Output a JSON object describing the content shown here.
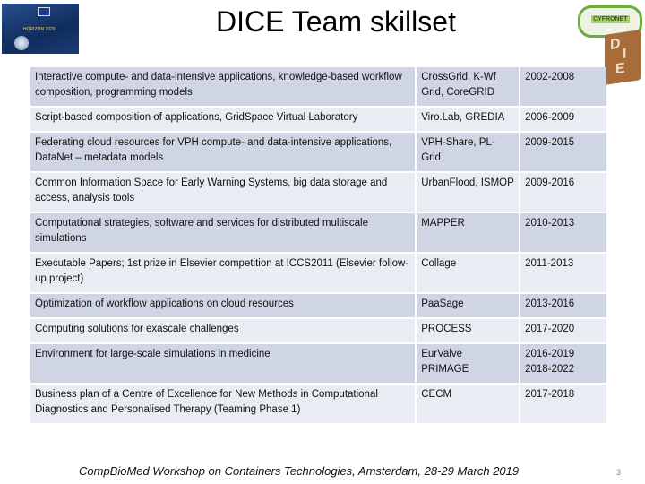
{
  "title": "DICE Team skillset",
  "logos": {
    "left": "HORIZON 2020",
    "right": [
      "CYFRONET",
      "DICE"
    ]
  },
  "rows": [
    {
      "topic": "Interactive compute- and data-intensive applications, knowledge-based workflow composition, programming models",
      "projects": "CrossGrid, K-Wf Grid, CoreGRID",
      "years": "2002-2008"
    },
    {
      "topic": "Script-based composition of applications, GridSpace Virtual Laboratory",
      "projects": "Viro.Lab, GREDIA",
      "years": "2006-2009"
    },
    {
      "topic": "Federating cloud resources  for  VPH compute- and data-intensive applications, DataNet – metadata models",
      "projects": "VPH-Share, PL-Grid",
      "years": "2009-2015"
    },
    {
      "topic": "Common Information Space for Early Warning Systems, big data storage and access, analysis tools",
      "projects": "UrbanFlood, ISMOP",
      "years": "2009-2016"
    },
    {
      "topic": "Computational strategies, software and services for distributed multiscale simulations",
      "projects": "MAPPER",
      "years": "2010-2013"
    },
    {
      "topic": "Executable Papers; 1st prize in Elsevier competition at ICCS2011 (Elsevier follow-up project)",
      "projects": "Collage",
      "years": "2011-2013"
    },
    {
      "topic": "Optimization of workflow applications on cloud resources",
      "projects": "PaaSage",
      "years": "2013-2016"
    },
    {
      "topic": "Computing solutions for exascale challenges",
      "projects": "PROCESS",
      "years": "2017-2020"
    },
    {
      "topic": "Environment for large-scale simulations in medicine",
      "projects": "EurValve\nPRIMAGE",
      "years": "2016-2019\n2018-2022"
    },
    {
      "topic": "Business plan of a Centre of Excellence for New Methods in Computational Diagnostics and Personalised Therapy (Teaming Phase 1)",
      "projects": "CECM",
      "years": "2017-2018"
    }
  ],
  "footer": "CompBioMed Workshop on Containers Technologies, Amsterdam,  28-29 March 2019",
  "page_number": "3"
}
